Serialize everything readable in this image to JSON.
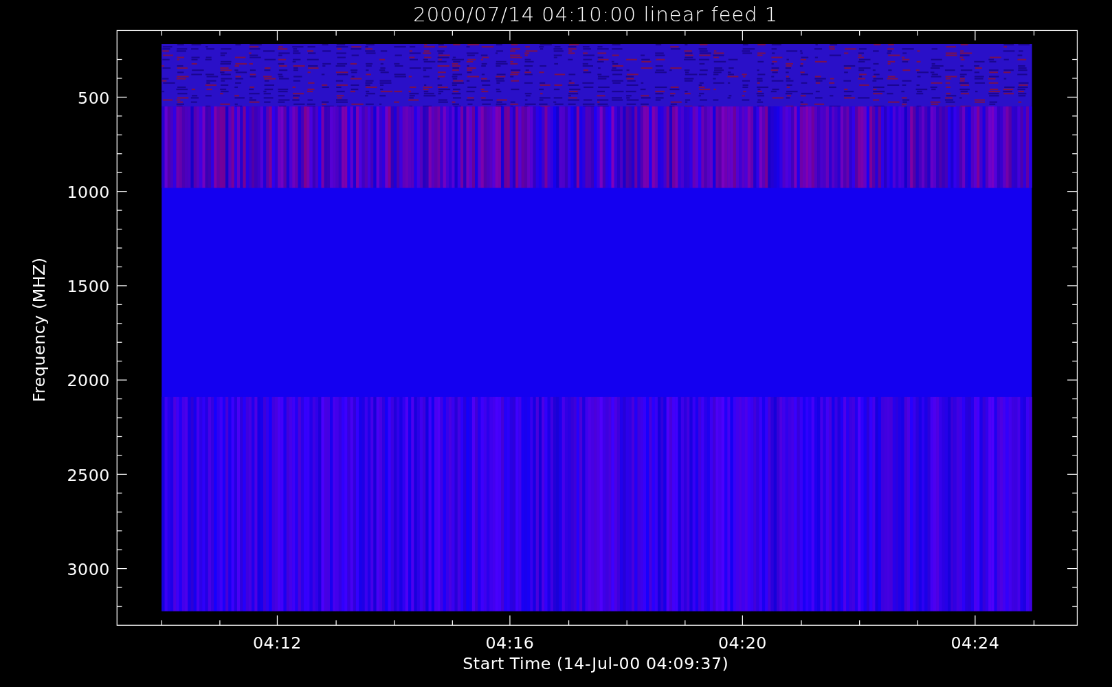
{
  "title": "2000/07/14 04:10:00 linear feed 1",
  "y_axis": {
    "label": "Frequency (MHZ)",
    "ticks": [
      "500",
      "1000",
      "1500",
      "2000",
      "2500",
      "3000"
    ]
  },
  "x_axis": {
    "label": "Start Time (14-Jul-00 04:09:37)",
    "ticks": [
      "04:12",
      "04:16",
      "04:20",
      "04:24"
    ]
  }
}
